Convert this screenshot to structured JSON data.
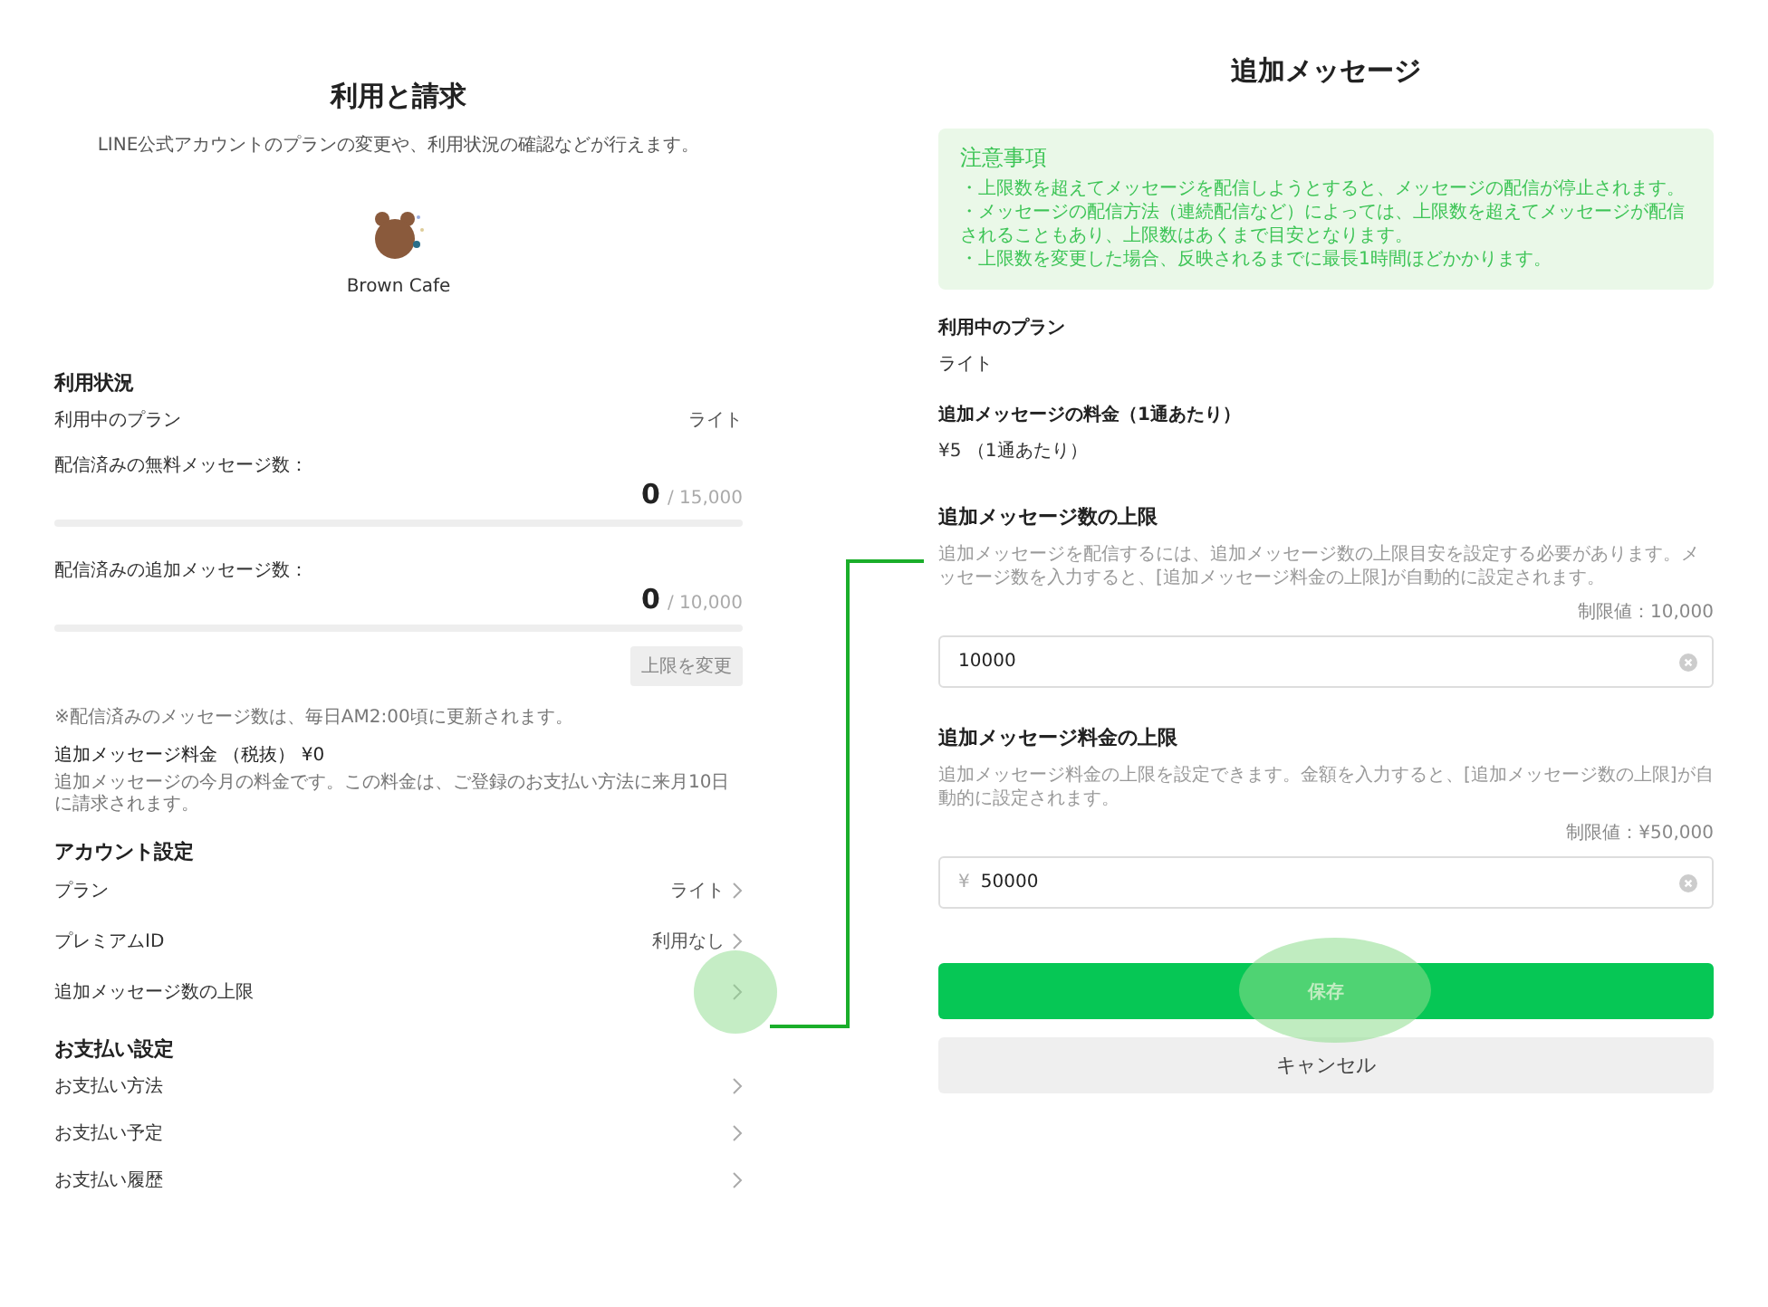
{
  "left": {
    "title": "利用と請求",
    "subtitle": "LINE公式アカウントのプランの変更や、利用状況の確認などが行えます。",
    "account_name": "Brown Cafe",
    "usage": {
      "heading": "利用状況",
      "plan_label": "利用中のプラン",
      "plan_value": "ライト",
      "meters": [
        {
          "label": "配信済みの無料メッセージ数：",
          "count": "0",
          "limit": "/ 15,000",
          "level": 0
        },
        {
          "label": "配信済みの追加メッセージ数：",
          "count": "0",
          "limit": "/ 10,000",
          "level": 0
        }
      ],
      "change_button": {
        "label": "上限を変更",
        "disabled": true
      },
      "note": "※配信済みのメッセージ数は、毎日AM2:00頃に更新されます。",
      "fee_label": "追加メッセージ料金 （税抜） ¥0",
      "fee_note": "追加メッセージの今月の料金です。この料金は、ご登録のお支払い方法に来月10日に請求されます。"
    },
    "account_settings": {
      "heading": "アカウント設定",
      "items": [
        {
          "label": "プラン",
          "value": "ライト",
          "tapped": false
        },
        {
          "label": "プレミアムID",
          "value": "利用なし",
          "tapped": false
        },
        {
          "label": "追加メッセージ数の上限",
          "tapped": true
        }
      ]
    },
    "payment_settings": {
      "heading": "お支払い設定",
      "items": [
        {
          "label": "お支払い方法",
          "tapped": false
        },
        {
          "label": "お支払い予定",
          "tapped": false
        },
        {
          "label": "お支払い履歴",
          "tapped": false
        }
      ]
    }
  },
  "right": {
    "title": "追加メッセージ",
    "notice": {
      "heading": "注意事項",
      "lines": [
        "・上限数を超えてメッセージを配信しようとすると、メッセージの配信が停止されます。",
        "・メッセージの配信方法（連続配信など）によっては、上限数を超えてメッセージが配信されることもあり、上限数はあくまで目安となります。",
        "・上限数を変更した場合、反映されるまでに最長1時間ほどかかります。"
      ]
    },
    "info": [
      {
        "label": "利用中のプラン",
        "value": "ライト"
      },
      {
        "label": "追加メッセージの料金（1通あたり）",
        "value": "¥5 （1通あたり）"
      }
    ],
    "limits": [
      {
        "heading": "追加メッセージ数の上限",
        "description": "追加メッセージを配信するには、追加メッセージ数の上限目安を設定する必要があります。メッセージ数を入力すると、[追加メッセージ料金の上限]が自動的に設定されます。",
        "max": "制限値：10,000",
        "value": "10000"
      },
      {
        "heading": "追加メッセージ料金の上限",
        "description": "追加メッセージ料金の上限を設定できます。金額を入力すると、[追加メッセージ数の上限]が自動的に設定されます。",
        "max": "制限値：¥50,000",
        "prefix": "¥",
        "value": "50000"
      }
    ],
    "save_button": {
      "label": "保存",
      "tapped": true
    },
    "cancel_button": {
      "label": "キャンセル"
    }
  }
}
